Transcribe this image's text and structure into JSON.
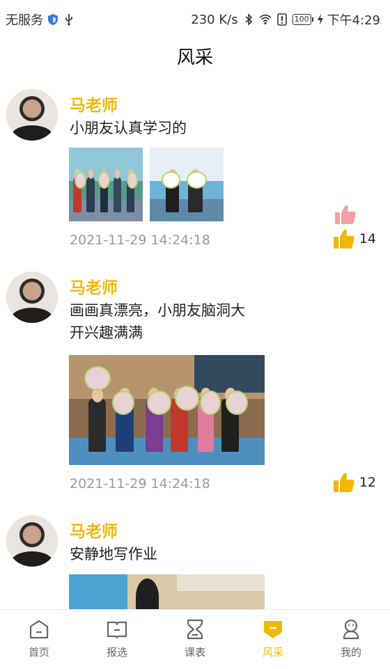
{
  "status_bar": {
    "carrier": "无服务",
    "speed": "230 K/s",
    "battery": "100",
    "time": "下午4:29"
  },
  "header": {
    "title": "风采"
  },
  "posts": [
    {
      "author": "马老师",
      "text_lines": [
        "小朋友认真学习的"
      ],
      "timestamp": "2021-11-29 14:24:18",
      "likes": "14",
      "liked": true
    },
    {
      "author": "马老师",
      "text_lines": [
        "画画真漂亮，小朋友脑洞大",
        "开兴趣满满"
      ],
      "timestamp": "2021-11-29 14:24:18",
      "likes": "12",
      "liked": false
    },
    {
      "author": "马老师",
      "text_lines": [
        "安静地写作业"
      ]
    }
  ],
  "nav": {
    "items": [
      {
        "label": "首页",
        "icon": "home-icon"
      },
      {
        "label": "报选",
        "icon": "book-icon"
      },
      {
        "label": "课表",
        "icon": "hourglass-icon"
      },
      {
        "label": "风采",
        "icon": "style-icon"
      },
      {
        "label": "我的",
        "icon": "profile-icon"
      }
    ]
  },
  "colors": {
    "accent": "#f2b705",
    "muted": "#9a9a9a",
    "like_pink": "#f4a0a6"
  }
}
